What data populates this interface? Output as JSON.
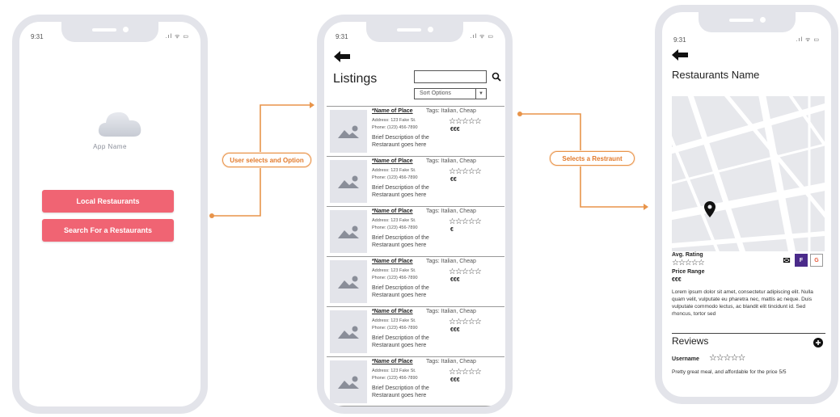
{
  "status": {
    "time": "9:31",
    "icons": ".ıl ᯤ ▭"
  },
  "phone1": {
    "app_name": "App Name",
    "buttons": [
      "Local Restaurants",
      "Search For a Restaurants"
    ]
  },
  "connectors": {
    "first": "User selects and Option",
    "second": "Selects a Restraunt"
  },
  "phone2": {
    "title": "Listings",
    "search_placeholder": "",
    "sort_label": "Sort Options",
    "rows": [
      {
        "name": "*Name of Place",
        "tags": "Tags: Italian, Cheap",
        "address": "Address: 123 Fake St.",
        "phone": "Phone: (123) 456-7890",
        "desc": "Brief Description of the Restaraunt goes here",
        "stars": "☆☆☆☆☆",
        "price": "€€€"
      },
      {
        "name": "*Name of Place",
        "tags": "Tags: Italian, Cheap",
        "address": "Address: 123 Fake St.",
        "phone": "Phone: (123) 456-7890",
        "desc": "Brief Description of the Restaraunt goes here",
        "stars": "☆☆☆☆☆",
        "price": "€€"
      },
      {
        "name": "*Name of Place",
        "tags": "Tags: Italian, Cheap",
        "address": "Address: 123 Fake St.",
        "phone": "Phone: (123) 456-7890",
        "desc": "Brief Description of the Restaraunt goes here",
        "stars": "☆☆☆☆☆",
        "price": "€"
      },
      {
        "name": "*Name of Place",
        "tags": "Tags: Italian, Cheap",
        "address": "Address: 123 Fake St.",
        "phone": "Phone: (123) 456-7890",
        "desc": "Brief Description of the Restaraunt goes here",
        "stars": "☆☆☆☆☆",
        "price": "€€€"
      },
      {
        "name": "*Name of Place",
        "tags": "Tags: Italian, Cheap",
        "address": "Address: 123 Fake St.",
        "phone": "Phone: (123) 456-7890",
        "desc": "Brief Description of the Restaraunt goes here",
        "stars": "☆☆☆☆☆",
        "price": "€€€"
      },
      {
        "name": "*Name of Place",
        "tags": "Tags: Italian, Cheap",
        "address": "Address: 123 Fake St.",
        "phone": "Phone: (123) 456-7890",
        "desc": "Brief Description of the Restaraunt goes here",
        "stars": "☆☆☆☆☆",
        "price": "€€€"
      }
    ]
  },
  "phone3": {
    "title": "Restaurants Name",
    "avg_label": "Avg. Rating",
    "avg_stars": "☆☆☆☆☆",
    "price_label": "Price Range",
    "price_value": "€€€",
    "social": {
      "mail": "✉",
      "facebook": "F",
      "google": "G"
    },
    "description": "Lorem ipsum dolor sit amet, consectetur adipiscing elit. Nulla quam velit, vulputate eu pharetra nec, mattis ac neque. Duis vulputate commodo lectus, ac blandit elit tincidunt id. Sed rhoncus, tortor sed",
    "reviews_title": "Reviews",
    "review": {
      "username": "Username",
      "stars": "☆☆☆☆☆",
      "text": "Pretty great meal, and affordable for the price 5/5"
    }
  },
  "colors": {
    "accent_red": "#f06473",
    "connector_orange": "#e8944a",
    "facebook": "#4a2a8a",
    "google": "#e85a3a"
  }
}
